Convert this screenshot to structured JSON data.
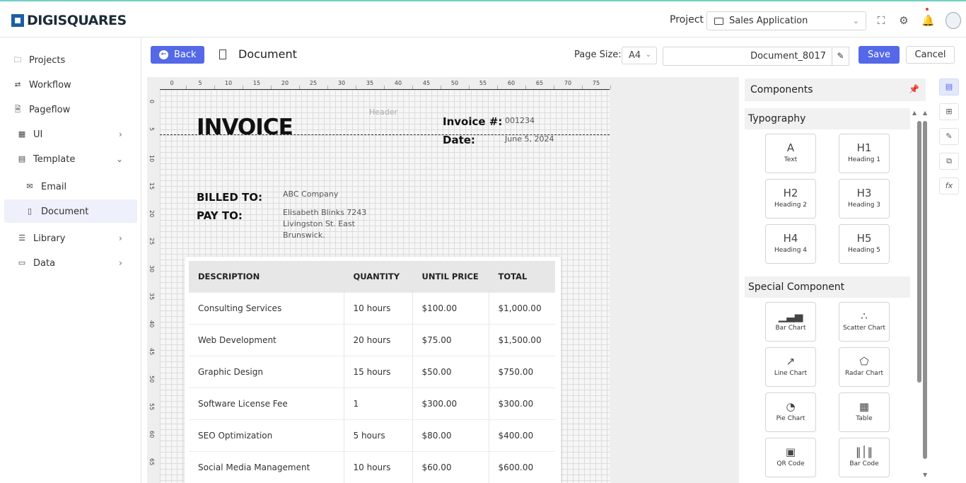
{
  "app": {
    "brand": "DIGISQUARES"
  },
  "header": {
    "project_label": "Project",
    "project_value": "Sales Application"
  },
  "sidebar": {
    "items": [
      {
        "label": "Projects"
      },
      {
        "label": "Workflow"
      },
      {
        "label": "Pageflow"
      },
      {
        "label": "UI"
      },
      {
        "label": "Template"
      },
      {
        "label": "Email"
      },
      {
        "label": "Document"
      },
      {
        "label": "Library"
      },
      {
        "label": "Data"
      }
    ]
  },
  "toolbar": {
    "back_label": "Back",
    "title": "Document",
    "page_size_label": "Page Size:",
    "page_size_value": "A4",
    "document_name": "Document_8017",
    "save_label": "Save",
    "cancel_label": "Cancel"
  },
  "ruler": {
    "top": [
      "0",
      "5",
      "10",
      "15",
      "20",
      "25",
      "30",
      "35",
      "40",
      "45",
      "50",
      "55",
      "60",
      "65",
      "70",
      "75"
    ],
    "left": [
      "0",
      "5",
      "10",
      "15",
      "20",
      "25",
      "30",
      "35",
      "40",
      "45",
      "50",
      "55",
      "60",
      "65"
    ]
  },
  "invoice": {
    "header_placeholder": "Header",
    "title": "INVOICE",
    "invoice_no_label": "Invoice #:",
    "invoice_no": "001234",
    "date_label": "Date:",
    "date": "June 5, 2024",
    "billed_to_label": "BILLED TO:",
    "billed_to": "ABC Company",
    "pay_to_label": "PAY TO:",
    "pay_to_line1": "Elisabeth Blinks 7243",
    "pay_to_line2": "Livingston St. East",
    "pay_to_line3": "Brunswick.",
    "columns": [
      "DESCRIPTION",
      "QUANTITY",
      "UNTIL PRICE",
      "TOTAL"
    ],
    "rows": [
      [
        "Consulting Services",
        "10 hours",
        "$100.00",
        "$1,000.00"
      ],
      [
        "Web Development",
        "20 hours",
        "$75.00",
        "$1,500.00"
      ],
      [
        "Graphic Design",
        "15 hours",
        "$50.00",
        "$750.00"
      ],
      [
        "Software License Fee",
        "1",
        "$300.00",
        "$300.00"
      ],
      [
        "SEO Optimization",
        "5 hours",
        "$80.00",
        "$400.00"
      ],
      [
        "Social Media Management",
        "10 hours",
        "$60.00",
        "$600.00"
      ]
    ]
  },
  "panel": {
    "title": "Components",
    "typography_title": "Typography",
    "typography": [
      {
        "glyph": "A",
        "label": "Text"
      },
      {
        "glyph": "H1",
        "label": "Heading 1"
      },
      {
        "glyph": "H2",
        "label": "Heading 2"
      },
      {
        "glyph": "H3",
        "label": "Heading 3"
      },
      {
        "glyph": "H4",
        "label": "Heading 4"
      },
      {
        "glyph": "H5",
        "label": "Heading 5"
      }
    ],
    "special_title": "Special Component",
    "special": [
      {
        "label": "Bar Chart",
        "icon": "bar-chart-icon"
      },
      {
        "label": "Scatter Chart",
        "icon": "scatter-chart-icon"
      },
      {
        "label": "Line Chart",
        "icon": "line-chart-icon"
      },
      {
        "label": "Radar Chart",
        "icon": "radar-chart-icon"
      },
      {
        "label": "Pie Chart",
        "icon": "pie-chart-icon"
      },
      {
        "label": "Table",
        "icon": "table-icon"
      },
      {
        "label": "QR Code",
        "icon": "qr-code-icon"
      },
      {
        "label": "Bar Code",
        "icon": "barcode-icon"
      }
    ]
  },
  "rail": {
    "fx_label": "fx"
  }
}
